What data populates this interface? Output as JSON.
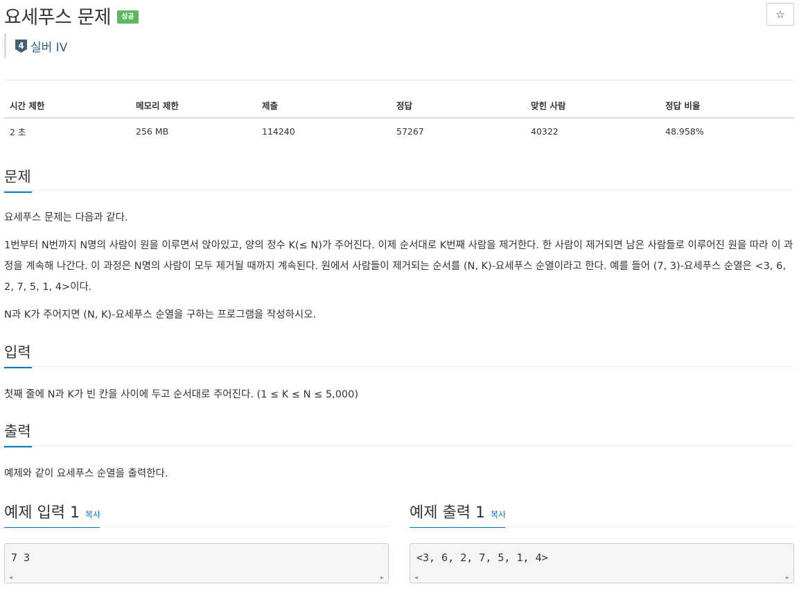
{
  "header": {
    "title": "요세푸스 문제",
    "status_badge": "성공",
    "tier_number": "4",
    "tier_label": "실버 IV",
    "star_icon": "☆"
  },
  "stats": {
    "headers": [
      "시간 제한",
      "메모리 제한",
      "제출",
      "정답",
      "맞힌 사람",
      "정답 비율"
    ],
    "values": [
      "2 초",
      "256 MB",
      "114240",
      "57267",
      "40322",
      "48.958%"
    ]
  },
  "sections": {
    "problem": {
      "title": "문제",
      "paragraphs": [
        "요세푸스 문제는 다음과 같다.",
        "1번부터 N번까지 N명의 사람이 원을 이루면서 앉아있고, 양의 정수 K(≤ N)가 주어진다. 이제 순서대로 K번째 사람을 제거한다. 한 사람이 제거되면 남은 사람들로 이루어진 원을 따라 이 과정을 계속해 나간다. 이 과정은 N명의 사람이 모두 제거될 때까지 계속된다. 원에서 사람들이 제거되는 순서를 (N, K)-요세푸스 순열이라고 한다. 예를 들어 (7, 3)-요세푸스 순열은 <3, 6, 2, 7, 5, 1, 4>이다.",
        "N과 K가 주어지면 (N, K)-요세푸스 순열을 구하는 프로그램을 작성하시오."
      ]
    },
    "input": {
      "title": "입력",
      "text": "첫째 줄에 N과 K가 빈 칸을 사이에 두고 순서대로 주어진다. (1 ≤ K ≤ N ≤ 5,000)"
    },
    "output": {
      "title": "출력",
      "text": "예제와 같이 요세푸스 순열을 출력한다."
    }
  },
  "examples": {
    "input": {
      "title": "예제 입력 1",
      "copy": "복사",
      "content": "7 3"
    },
    "output": {
      "title": "예제 출력 1",
      "copy": "복사",
      "content": "<3, 6, 2, 7, 5, 1, 4>"
    }
  },
  "colors": {
    "accent": "#0076c0",
    "success": "#5cb85c",
    "tier": "#2c5f89"
  }
}
